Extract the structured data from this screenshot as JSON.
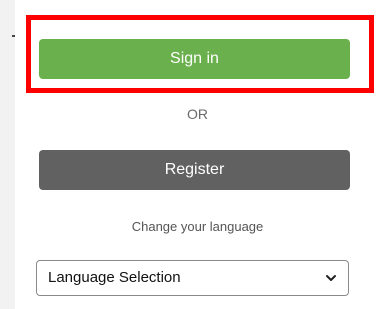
{
  "auth": {
    "signin_label": "Sign in",
    "or_label": "OR",
    "register_label": "Register"
  },
  "language": {
    "caption": "Change your language",
    "selected_value": "Language Selection"
  },
  "colors": {
    "signin_bg": "#6ab04c",
    "register_bg": "#616161",
    "highlight": "#ff0000"
  },
  "icons": {
    "select_arrow": "chevron-down-icon"
  }
}
